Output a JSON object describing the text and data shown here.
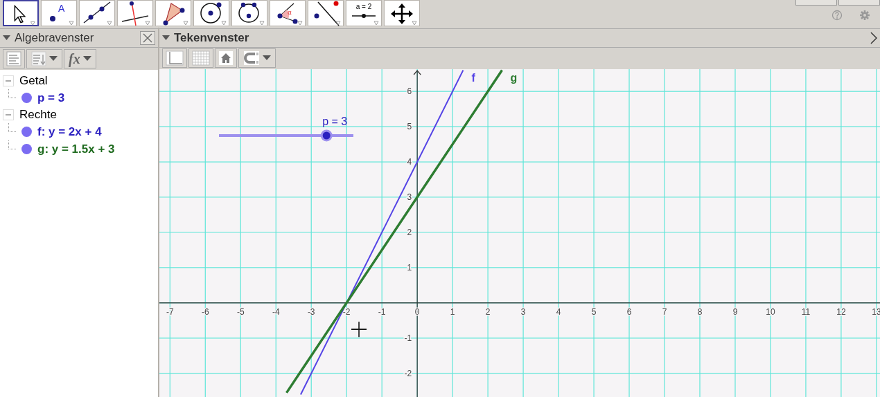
{
  "toolbar": {
    "tools": [
      {
        "kind": "move",
        "selected": true
      },
      {
        "kind": "point",
        "label": "A",
        "selected": false
      },
      {
        "kind": "line",
        "selected": false
      },
      {
        "kind": "perpendicular",
        "selected": false
      },
      {
        "kind": "polygon",
        "selected": false
      },
      {
        "kind": "circle",
        "selected": false
      },
      {
        "kind": "conic",
        "selected": false
      },
      {
        "kind": "angle",
        "label": "α",
        "selected": false
      },
      {
        "kind": "reflect",
        "selected": false
      },
      {
        "kind": "slider",
        "label": "a = 2",
        "selected": false
      },
      {
        "kind": "move-view",
        "selected": false
      }
    ]
  },
  "algebra": {
    "title": "Algebravenster",
    "buttons": [
      {
        "kind": "list"
      },
      {
        "kind": "sort"
      },
      {
        "kind": "input",
        "label": "fx"
      }
    ],
    "groups": [
      {
        "label": "Getal",
        "expanded": true,
        "children": [
          {
            "label": "p = 3",
            "color": "#2a1fc0",
            "visible": true
          }
        ]
      },
      {
        "label": "Rechte",
        "expanded": true,
        "children": [
          {
            "label": "f: y = 2x + 4",
            "color": "#2a1fc0",
            "visible": true
          },
          {
            "label": "g: y = 1.5x + 3",
            "color": "#1f6b1f",
            "visible": true
          }
        ]
      }
    ]
  },
  "graphics": {
    "title": "Tekenvenster",
    "buttons": [
      {
        "kind": "axes"
      },
      {
        "kind": "grid"
      },
      {
        "kind": "home"
      },
      {
        "kind": "snap"
      }
    ],
    "slider": {
      "label": "p = 3",
      "level": 0.8
    },
    "chart_data": {
      "type": "line",
      "x": [
        -3.7,
        -3.3,
        1.3,
        2.4
      ],
      "series": [
        {
          "name": "f",
          "color": "#5544e6",
          "values": [
            null,
            -2.6,
            6.6,
            null
          ]
        },
        {
          "name": "g",
          "color": "#2e7d32",
          "values": [
            -2.55,
            -1.95,
            4.95,
            6.6
          ]
        }
      ],
      "grid": true,
      "xlim": [
        -7.3,
        13.1
      ],
      "ylim": [
        -2.67,
        6.63
      ],
      "xticks": [
        -7,
        -6,
        -5,
        -4,
        -3,
        -2,
        -1,
        0,
        1,
        2,
        3,
        4,
        5,
        6,
        7,
        8,
        9,
        10,
        11,
        12,
        13
      ],
      "yticks": [
        -2,
        -1,
        1,
        2,
        3,
        4,
        5,
        6
      ]
    }
  }
}
